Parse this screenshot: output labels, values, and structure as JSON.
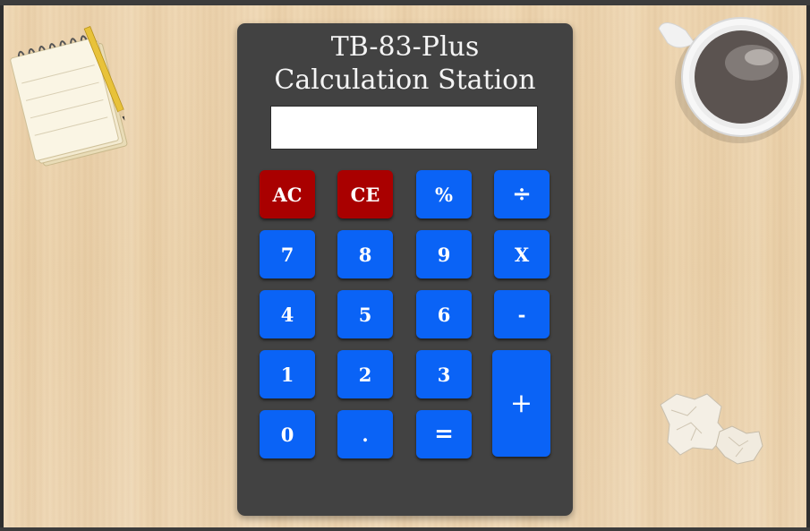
{
  "calculator": {
    "title_line1": "TB-83-Plus",
    "title_line2": "Calculation Station",
    "display_value": "",
    "keys": {
      "ac": "AC",
      "ce": "CE",
      "percent": "%",
      "divide": "÷",
      "seven": "7",
      "eight": "8",
      "nine": "9",
      "multiply": "X",
      "four": "4",
      "five": "5",
      "six": "6",
      "subtract": "-",
      "one": "1",
      "two": "2",
      "three": "3",
      "add": "+",
      "zero": "0",
      "decimal": ".",
      "equals": "="
    }
  },
  "colors": {
    "calculator_body": "#424242",
    "key_blue": "#0a63f6",
    "key_red": "#a90000",
    "display_bg": "#ffffff"
  },
  "decorations": [
    "notepad-with-pencil-icon",
    "coffee-cup-icon",
    "crumpled-paper-icon"
  ]
}
